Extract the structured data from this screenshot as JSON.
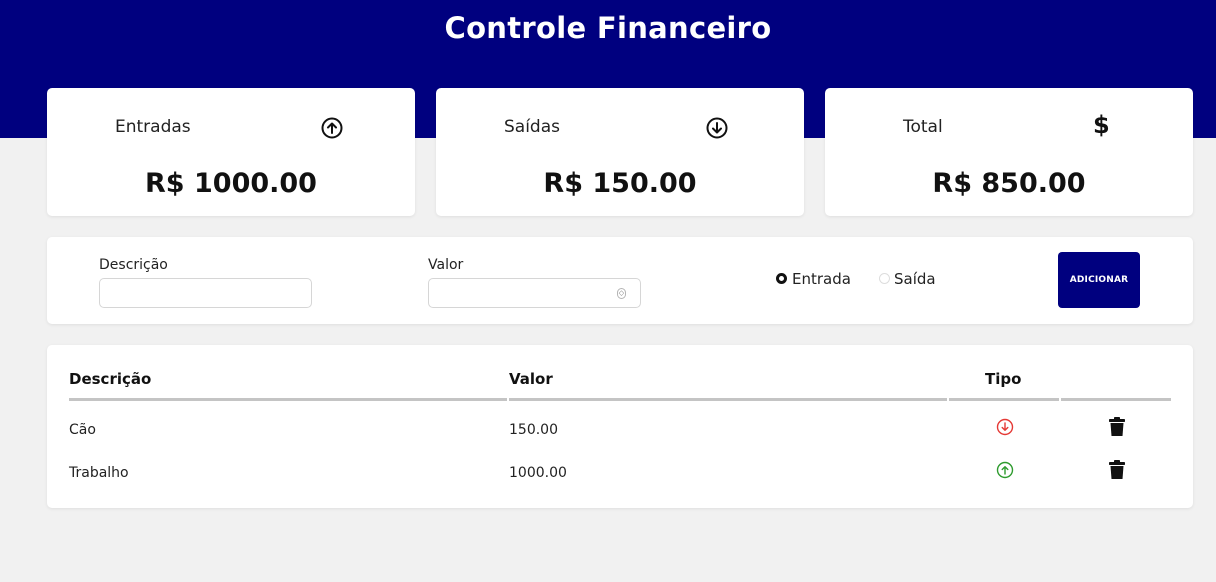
{
  "header": {
    "title": "Controle Financeiro"
  },
  "summary": {
    "entradas": {
      "label": "Entradas",
      "value": "R$ 1000.00",
      "icon": "arrow-up-circle-icon"
    },
    "saidas": {
      "label": "Saídas",
      "value": "R$ 150.00",
      "icon": "arrow-down-circle-icon"
    },
    "total": {
      "label": "Total",
      "value": "R$ 850.00",
      "symbol": "$"
    }
  },
  "form": {
    "descricao_label": "Descrição",
    "descricao_value": "",
    "valor_label": "Valor",
    "valor_value": "",
    "radio_entrada_label": "Entrada",
    "radio_saida_label": "Saída",
    "selected_type": "Entrada",
    "add_button_label": "ADICIONAR"
  },
  "table": {
    "headers": [
      "Descrição",
      "Valor",
      "Tipo"
    ],
    "rows": [
      {
        "descricao": "Cão",
        "valor": "150.00",
        "tipo": "saida"
      },
      {
        "descricao": "Trabalho",
        "valor": "1000.00",
        "tipo": "entrada"
      }
    ]
  },
  "colors": {
    "brand": "#00007f",
    "saida_icon": "#e53935",
    "entrada_icon": "#2e9b2e",
    "background": "#f1f1f1"
  }
}
